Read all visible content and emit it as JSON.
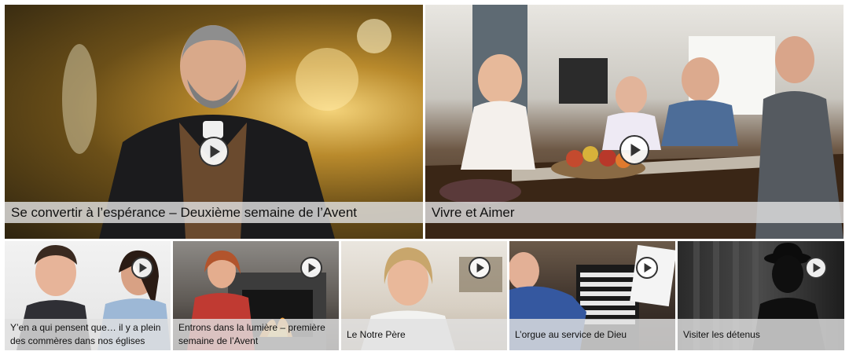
{
  "featured": [
    {
      "title": "Se convertir à l’espérance – Deuxième semaine de l’Avent",
      "thumb_icon": "priest-portrait-image",
      "action_icon": "play-icon"
    },
    {
      "title": "Vivre et Aimer",
      "thumb_icon": "family-table-image",
      "action_icon": "play-icon"
    }
  ],
  "videos": [
    {
      "title": "Y’en a qui pensent que… il y a plein des commères dans nos églises",
      "thumb_icon": "two-women-image",
      "action_icon": "play-icon"
    },
    {
      "title": "Entrons dans la lumière – première semaine de l’Avent",
      "thumb_icon": "fireplace-woman-image",
      "action_icon": "play-icon"
    },
    {
      "title": "Le Notre Père",
      "thumb_icon": "woman-portrait-image",
      "action_icon": "play-icon"
    },
    {
      "title": "L’orgue au service de Dieu",
      "thumb_icon": "organist-image",
      "action_icon": "play-icon"
    },
    {
      "title": "Visiter les détenus",
      "thumb_icon": "silhouette-image",
      "action_icon": "play-icon"
    }
  ],
  "colors": {
    "caption_bg": "#e1e1e1",
    "caption_text": "#111111",
    "play_bg": "#ffffff",
    "play_border": "#333333"
  }
}
